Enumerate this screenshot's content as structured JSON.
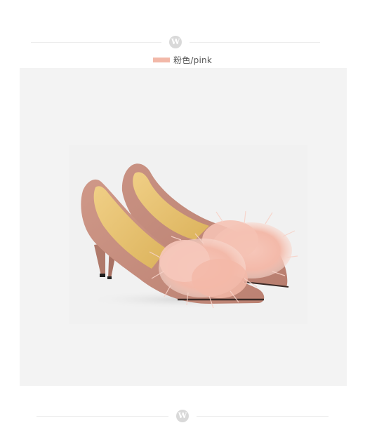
{
  "brand_badge": "W",
  "color_option": {
    "label": "粉色/pink",
    "swatch_color": "#f2b8a8"
  },
  "product_image": {
    "icon": "pink-feather-pumps-photo"
  },
  "colors": {
    "suede": "#c58c7d",
    "lining": "#ecc46e",
    "feather": "#f4c0b2",
    "panel": "#f3f3f3"
  }
}
